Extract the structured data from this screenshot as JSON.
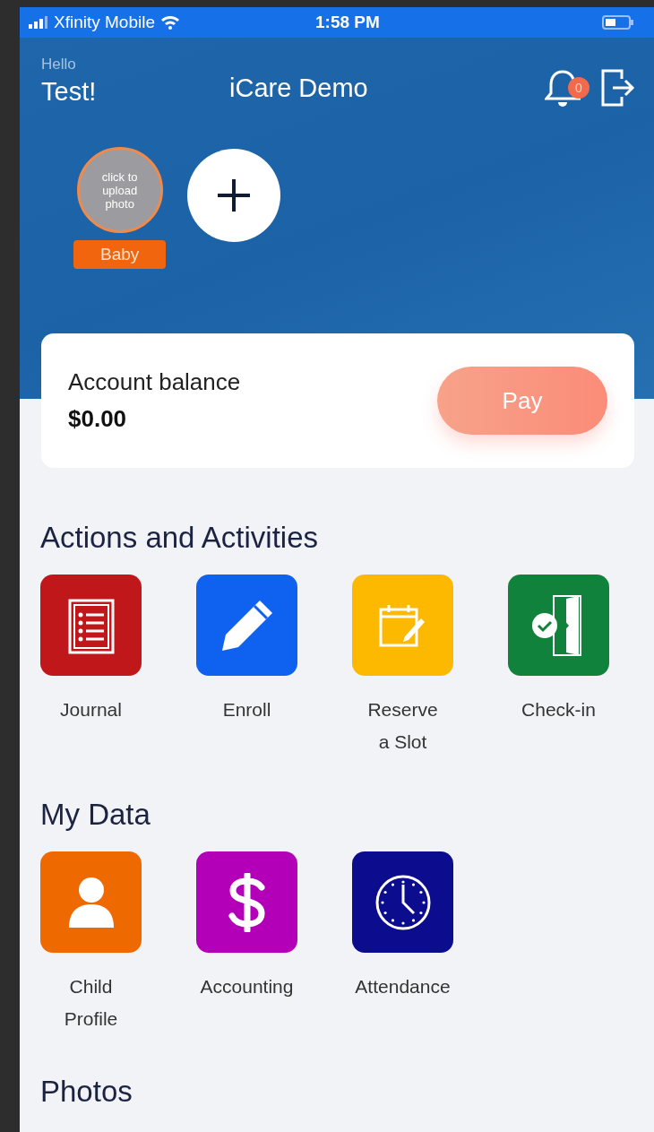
{
  "status_bar": {
    "carrier": "Xfinity Mobile",
    "time": "1:58 PM"
  },
  "header": {
    "greeting": "Hello",
    "user": "Test!",
    "title": "iCare Demo",
    "notification_count": "0"
  },
  "children": [
    {
      "photo_hint": "click to upload photo",
      "name": "Baby",
      "selected": true
    }
  ],
  "balance": {
    "label": "Account balance",
    "amount": "$0.00",
    "button": "Pay"
  },
  "sections": [
    {
      "title": "Actions and Activities",
      "items": [
        {
          "label": "Journal",
          "kind": "clipboard",
          "color": "#c0171a"
        },
        {
          "label": "Enroll",
          "kind": "pencil",
          "color": "#0f62f0"
        },
        {
          "label": "Reserve\na Slot",
          "kind": "calendar",
          "color": "#fcb900"
        },
        {
          "label": "Check-in",
          "kind": "door",
          "color": "#11823b"
        }
      ]
    },
    {
      "title": "My Data",
      "items": [
        {
          "label": "Child\nProfile",
          "kind": "person",
          "color": "#ee6a00"
        },
        {
          "label": "Accounting",
          "kind": "dollar",
          "color": "#b300b8"
        },
        {
          "label": "Attendance",
          "kind": "clock",
          "color": "#0b0c8e"
        }
      ]
    },
    {
      "title": "Photos"
    }
  ]
}
